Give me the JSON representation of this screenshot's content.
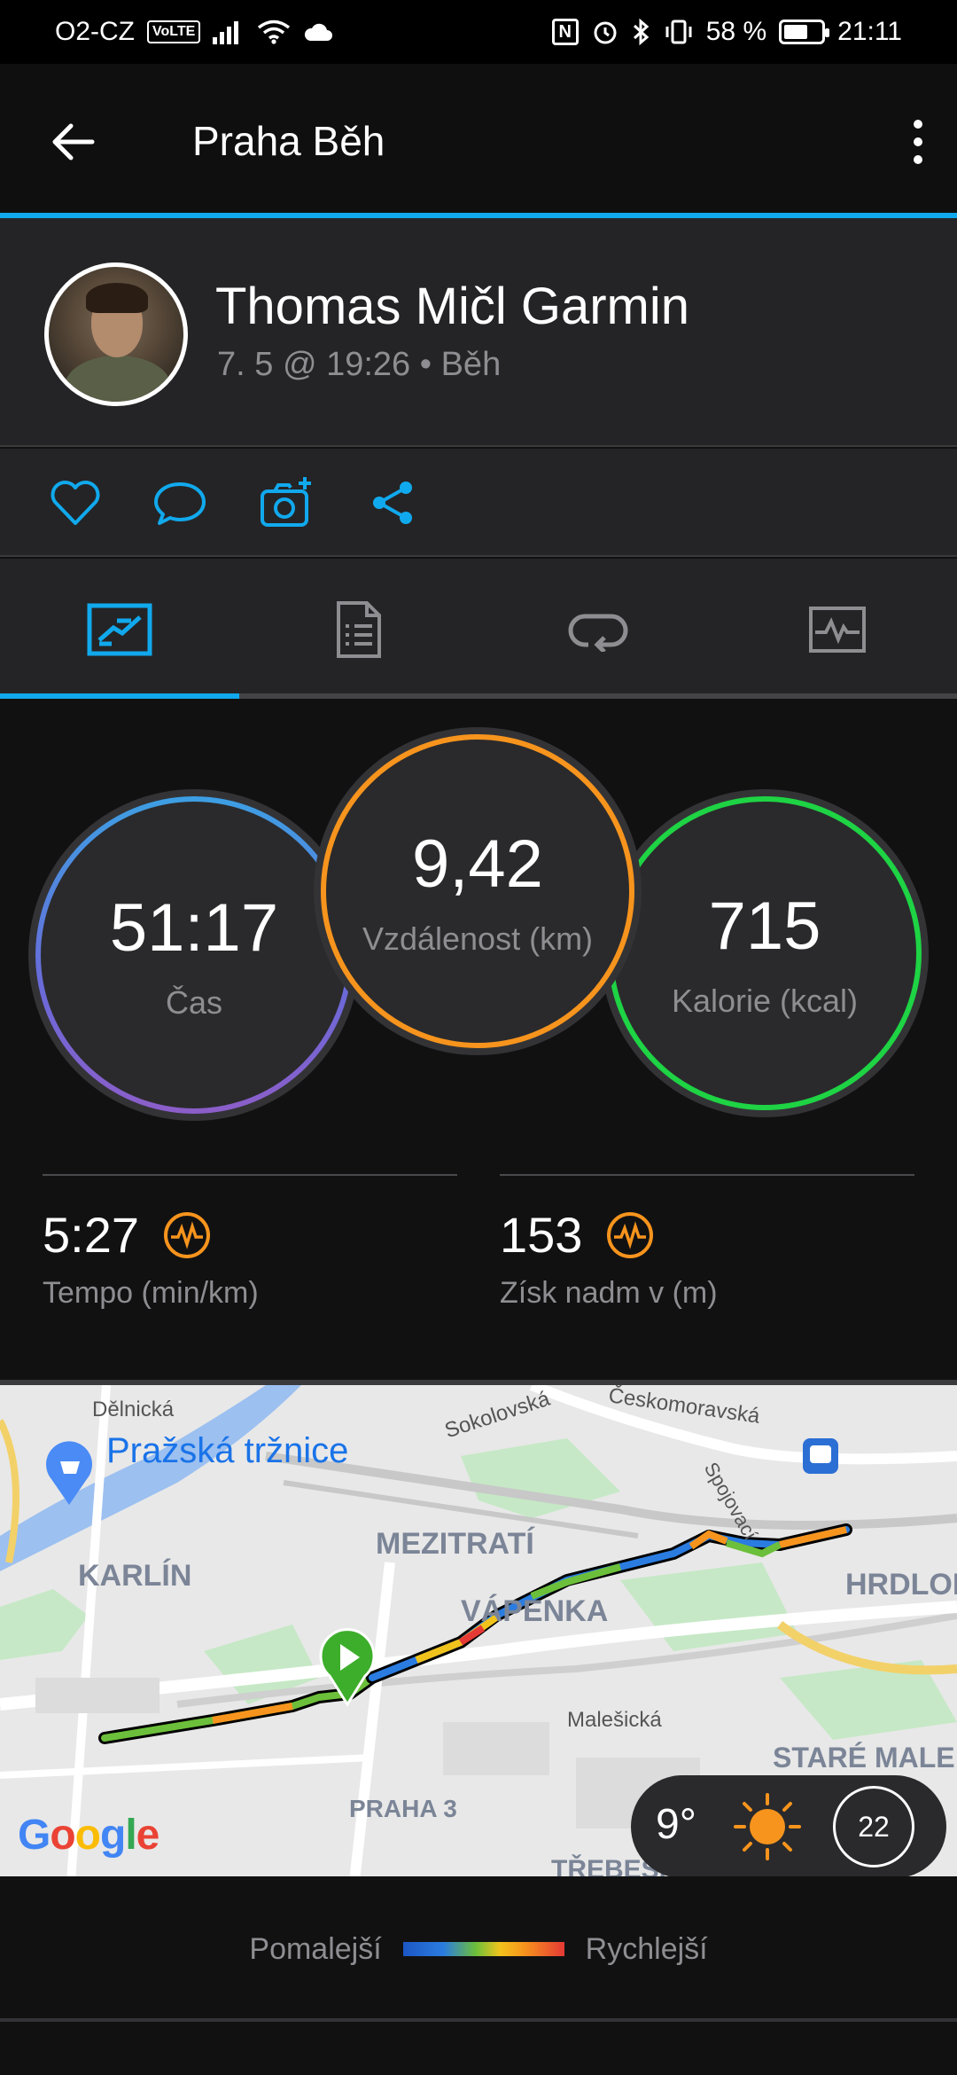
{
  "status_bar": {
    "carrier": "O2-CZ",
    "volte": "VoLTE",
    "battery": "58 %",
    "time": "21:11"
  },
  "app_bar": {
    "title": "Praha Běh"
  },
  "activity": {
    "user_name": "Thomas Mičl Garmin",
    "meta": "7. 5 @ 19:26 • Běh"
  },
  "actions": [
    "like-icon",
    "comment-icon",
    "add-photo-icon",
    "share-icon"
  ],
  "tabs": [
    "overview",
    "details",
    "laps",
    "charts"
  ],
  "stats": {
    "time_value": "51:17",
    "time_label": "Čas",
    "distance_value": "9,42",
    "distance_label": "Vzdálenost (km)",
    "calories_value": "715",
    "calories_label": "Kalorie (kcal)",
    "pace_value": "5:27",
    "pace_label": "Tempo (min/km)",
    "elevation_value": "153",
    "elevation_label": "Získ nadm v (m)"
  },
  "map": {
    "labels": {
      "delnicka": "Dělnická",
      "prazska_trznice": "Pražská tržnice",
      "sokolovska": "Sokolovská",
      "ceskomoravska": "Českomoravská",
      "mezitrati": "MEZITRATÍ",
      "karlin": "KARLÍN",
      "vapenka": "VÁPENKA",
      "hrdlorezy": "HRDLOŘ",
      "malesicka": "Malešická",
      "stare_male": "STARÉ MALE",
      "praha3": "PRAHA 3",
      "trebesin": "TŘEBESÍN",
      "spojovaci": "Spojovací"
    },
    "google": "Google",
    "weather_temp": "9°",
    "wind_speed": "22"
  },
  "legend": {
    "slower": "Pomalejší",
    "faster": "Rychlejší"
  },
  "colors": {
    "accent": "#11a9ed",
    "orange": "#f7941d",
    "green": "#1ed344"
  }
}
